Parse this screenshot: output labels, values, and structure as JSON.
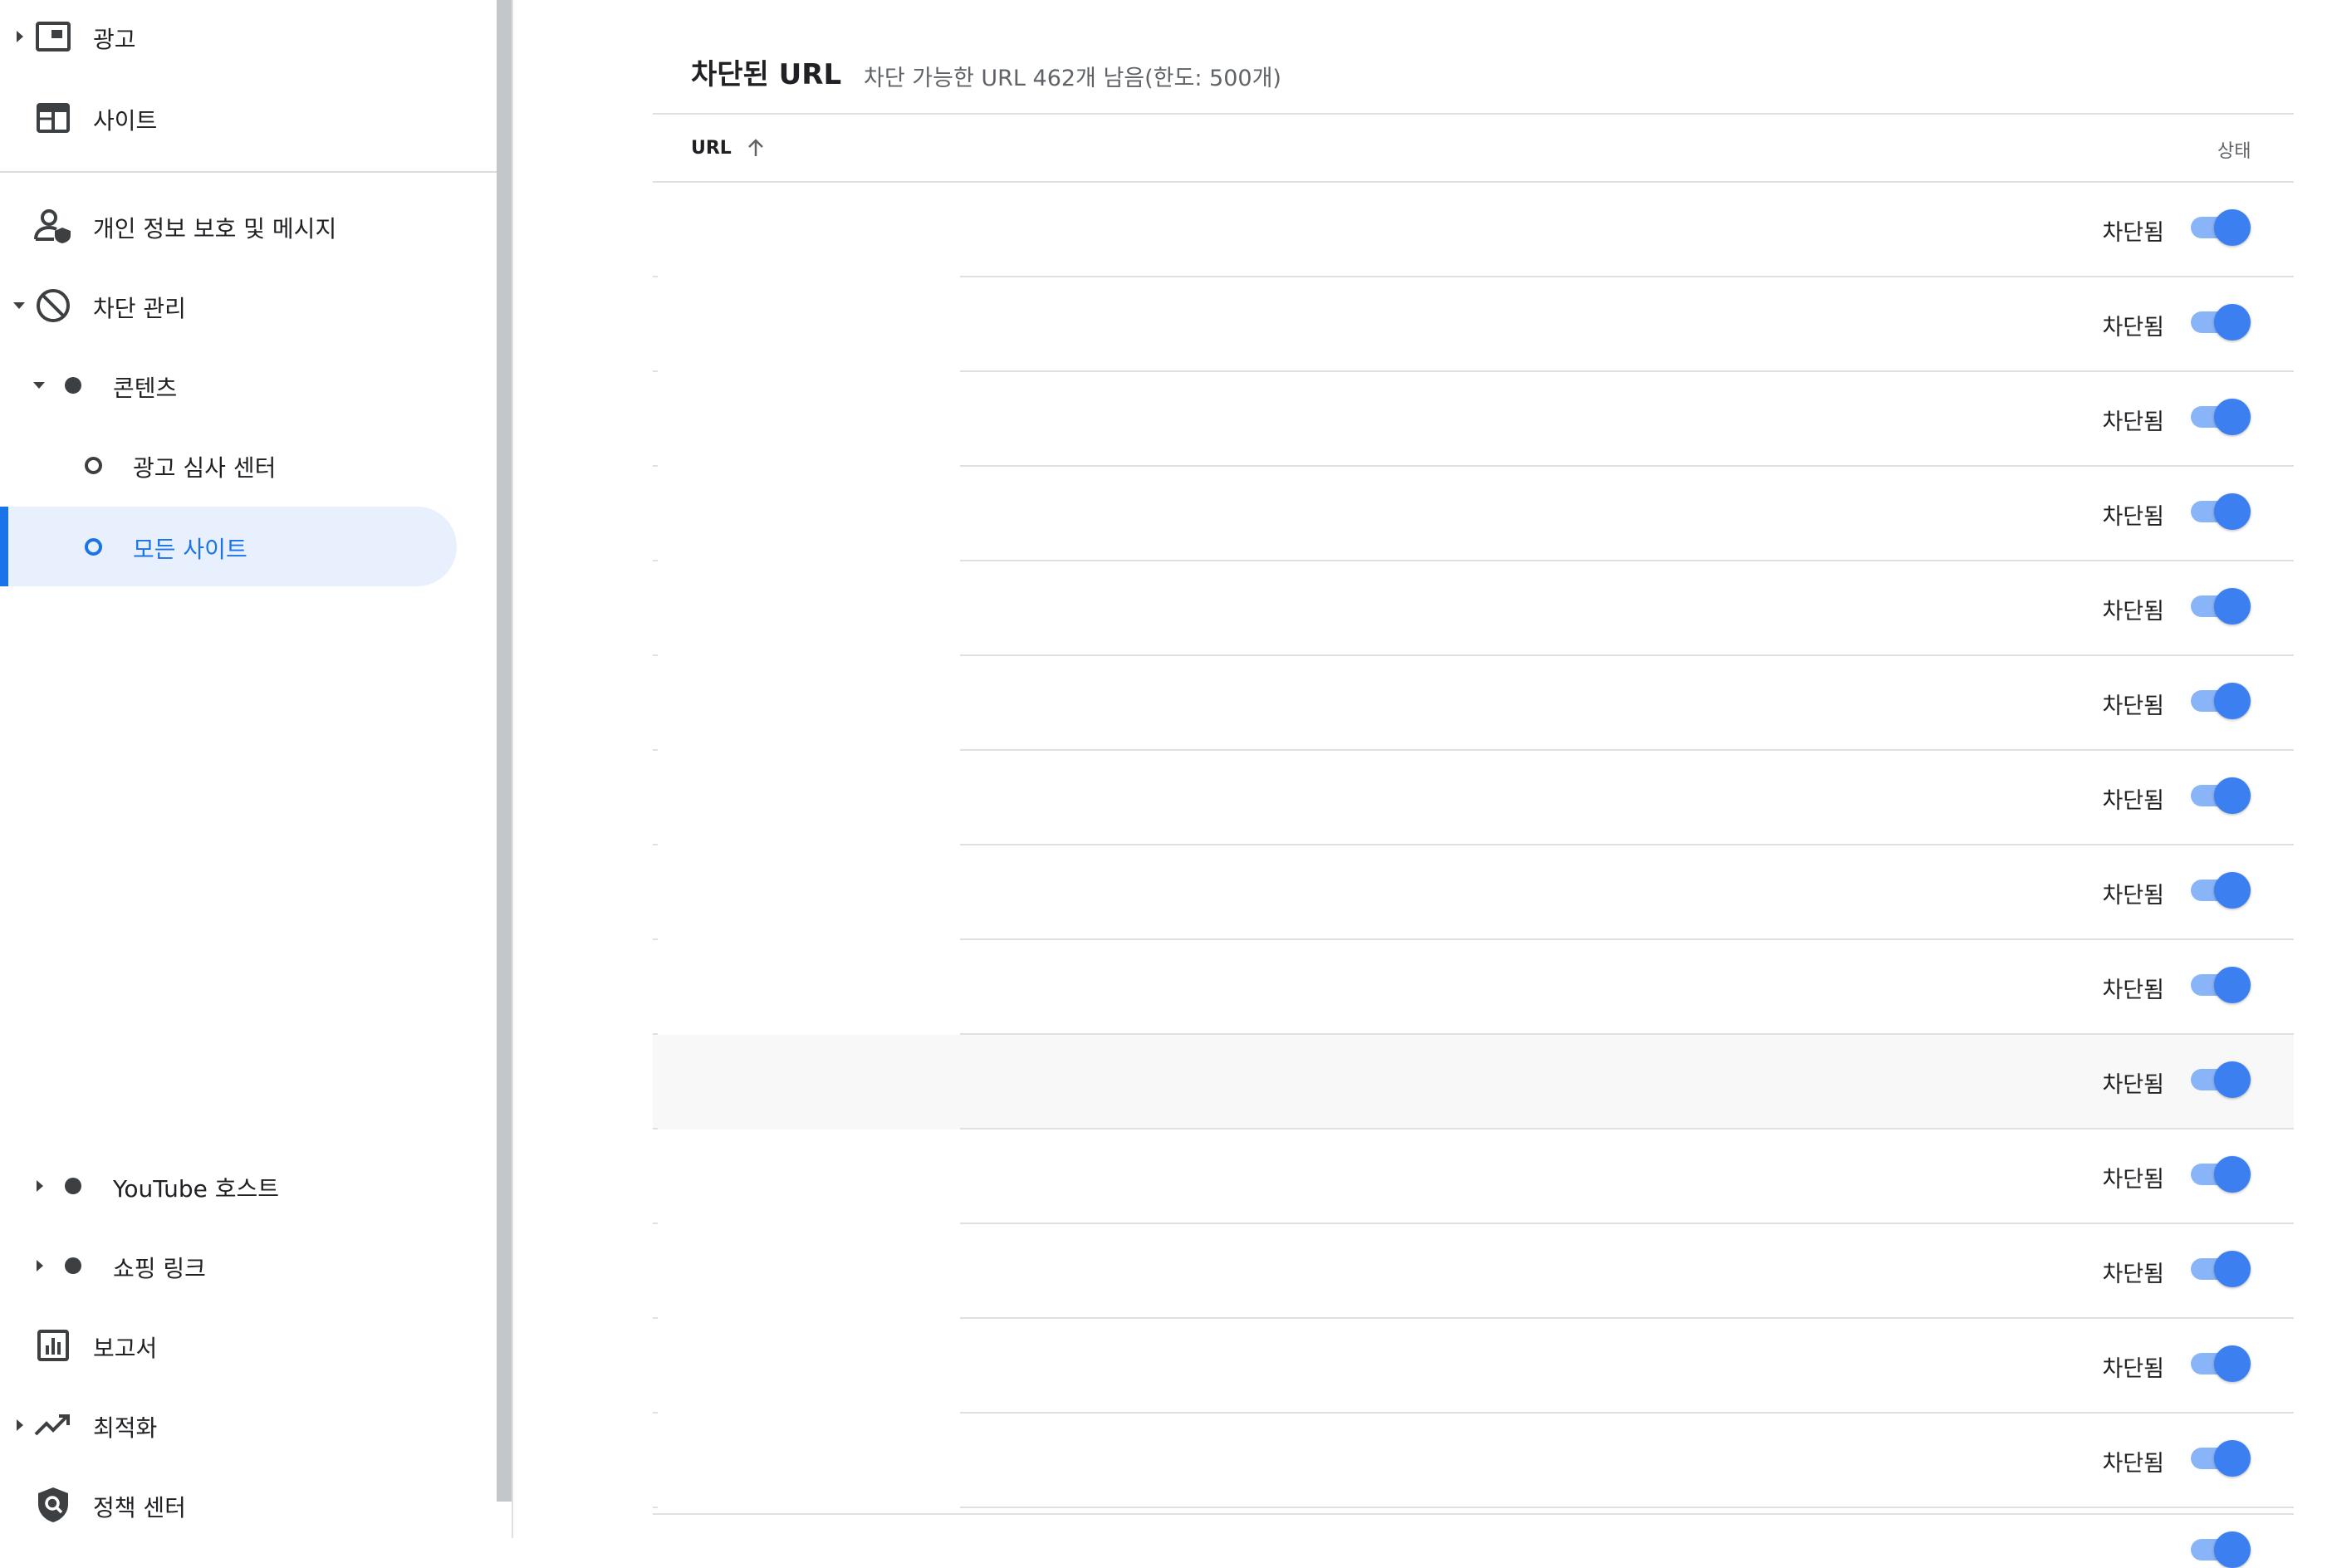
{
  "sidebar": {
    "items": [
      {
        "id": "ads",
        "label": "광고",
        "icon": "ad-unit-icon",
        "expanded": false
      },
      {
        "id": "sites",
        "label": "사이트",
        "icon": "web-layout-icon"
      },
      {
        "id": "privacy",
        "label": "개인 정보 보호 및 메시지",
        "icon": "person-shield-icon"
      },
      {
        "id": "blocking",
        "label": "차단 관리",
        "icon": "block-icon",
        "expanded": true
      },
      {
        "id": "content",
        "label": "콘텐츠",
        "expanded": true
      },
      {
        "id": "ad-review",
        "label": "광고 심사 센터"
      },
      {
        "id": "all-sites",
        "label": "모든 사이트",
        "active": true
      },
      {
        "id": "youtube-host",
        "label": "YouTube 호스트",
        "expanded": false
      },
      {
        "id": "shopping-links",
        "label": "쇼핑 링크",
        "expanded": false
      },
      {
        "id": "reports",
        "label": "보고서",
        "icon": "bar-chart-icon"
      },
      {
        "id": "optimization",
        "label": "최적화",
        "icon": "trending-up-icon",
        "expanded": false
      },
      {
        "id": "policy-center",
        "label": "정책 센터",
        "icon": "policy-shield-icon"
      }
    ]
  },
  "main": {
    "title": "차단된 URL",
    "subtitle": "차단 가능한 URL 462개 남음(한도: 500개)",
    "columns": {
      "url": "URL",
      "status": "상태"
    },
    "sort": "ascending",
    "rows": [
      {
        "status": "차단됨",
        "on": true
      },
      {
        "status": "차단됨",
        "on": true
      },
      {
        "status": "차단됨",
        "on": true
      },
      {
        "status": "차단됨",
        "on": true
      },
      {
        "status": "차단됨",
        "on": true
      },
      {
        "status": "차단됨",
        "on": true
      },
      {
        "status": "차단됨",
        "on": true
      },
      {
        "status": "차단됨",
        "on": true
      },
      {
        "status": "차단됨",
        "on": true
      },
      {
        "status": "차단됨",
        "on": true
      },
      {
        "status": "차단됨",
        "on": true
      },
      {
        "status": "차단됨",
        "on": true
      },
      {
        "status": "차단됨",
        "on": true
      },
      {
        "status": "차단됨",
        "on": true
      }
    ]
  },
  "colors": {
    "accent": "#1a73e8",
    "active_bg": "#e8f0fe",
    "toggle_track": "#8ab4f8",
    "toggle_thumb": "#3c7ff0"
  }
}
